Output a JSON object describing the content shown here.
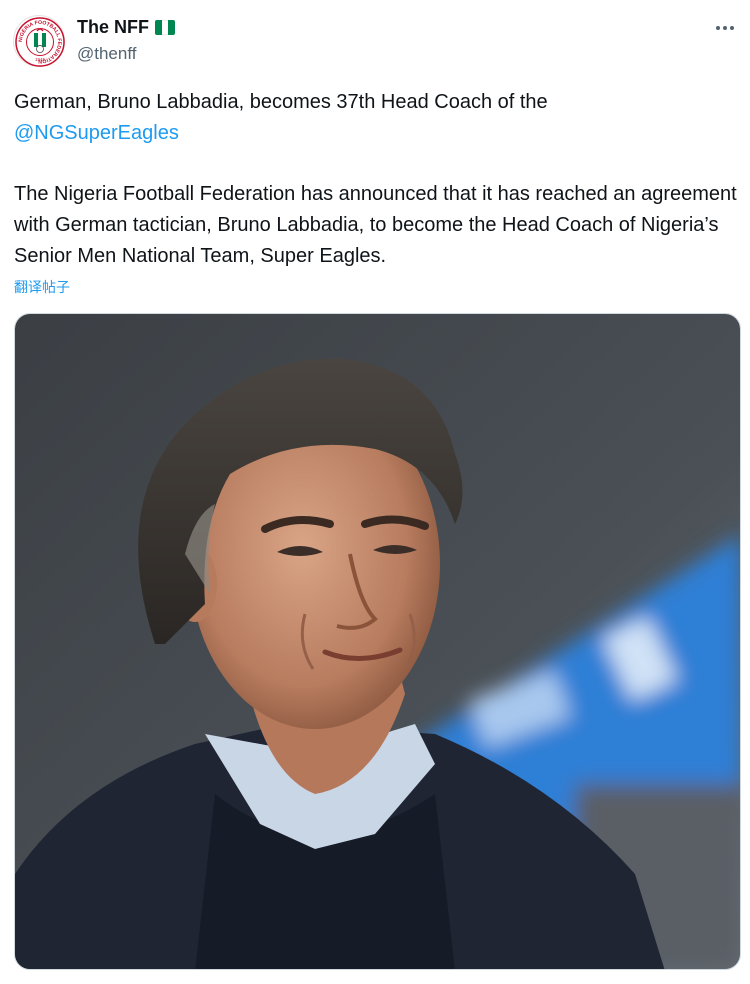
{
  "author": {
    "display_name": "The NFF",
    "handle": "@thenff",
    "flag_colors": [
      "#008751",
      "#ffffff",
      "#008751"
    ],
    "avatar_text": "NIGERIA FOOTBALL FEDERATION",
    "avatar_year": "1945"
  },
  "tweet": {
    "line1_text": "German, Bruno Labbadia, becomes 37th Head Coach of the ",
    "line1_mention": "@NGSuperEagles",
    "body": "The Nigeria Football Federation has announced that it has reached an agreement with German tactician, Bruno Labbadia, to become the Head Coach of Nigeria’s Senior Men National Team, Super Eagles.",
    "translate_label": "翻译帖子"
  },
  "colors": {
    "accent": "#1d9bf0",
    "text": "#0f1419",
    "secondary": "#536471"
  },
  "icons": {
    "more": "more-icon",
    "avatar": "nff-logo"
  }
}
